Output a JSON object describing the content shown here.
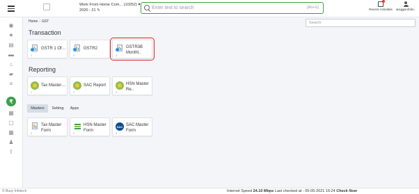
{
  "header": {
    "company_line1": "Work From Home Com... (10252)",
    "company_line2": "2020 - 21",
    "search_placeholder": "Enter text to search",
    "search_hint": "[Alt+G]",
    "recent_label": "Recent Activities",
    "user_label": "anujgal.shim.."
  },
  "breadcrumb": {
    "home": "Home",
    "current": "GST"
  },
  "page_search_placeholder": "Search",
  "sections": {
    "transaction": {
      "title": "Transaction",
      "tiles": [
        {
          "label": "GSTR 1 Offline...",
          "num": "1"
        },
        {
          "label": "GSTR2",
          "num": "2"
        },
        {
          "label": "GSTR3B Monthl..",
          "num": "3"
        }
      ]
    },
    "reporting": {
      "title": "Reporting",
      "tiles": [
        {
          "label": "Tax Master Re...",
          "num": "1"
        },
        {
          "label": "SAC Report",
          "num": "2"
        },
        {
          "label": "HSN Master Re..",
          "num": "3"
        }
      ]
    },
    "masters": {
      "tiles": [
        {
          "label": "Tax Master Form",
          "num": "1"
        },
        {
          "label": "HSN Master Form",
          "num": "2"
        },
        {
          "label": "SAC Master Form",
          "num": "3",
          "icon_text": "SAC"
        }
      ]
    }
  },
  "tabs": [
    {
      "label": "Masters"
    },
    {
      "label": "Setting"
    },
    {
      "label": "Apps"
    }
  ],
  "status": {
    "left": "© Busy Infotech",
    "speed_prefix": "Internet Speed",
    "speed_value": "24.10 Mbps",
    "checked": "Last checked at - 05-05-2021 16:24",
    "check_now": "Check Now"
  },
  "colors": {
    "accent_green": "#3aa14a",
    "selected_outline": "#e02424"
  },
  "icons": [
    "dashboard-icon",
    "star-icon",
    "document-icon",
    "truck-icon",
    "bank-icon",
    "folder-icon",
    "rupee-icon",
    "report-icon",
    "calendar-icon",
    "users-icon",
    "upload-icon"
  ]
}
